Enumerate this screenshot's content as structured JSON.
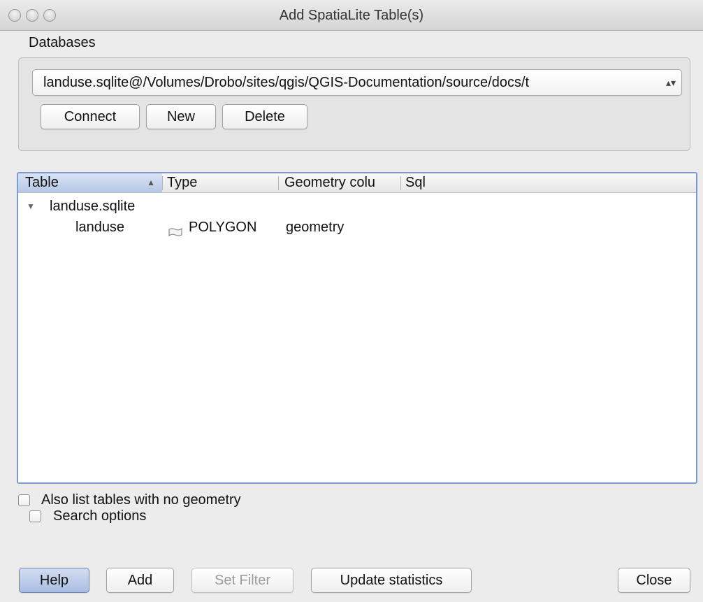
{
  "window": {
    "title": "Add SpatiaLite Table(s)"
  },
  "databases": {
    "label": "Databases",
    "selected": "landuse.sqlite@/Volumes/Drobo/sites/qgis/QGIS-Documentation/source/docs/t",
    "buttons": {
      "connect": "Connect",
      "new": "New",
      "delete": "Delete"
    }
  },
  "tree": {
    "columns": [
      "Table",
      "Type",
      "Geometry colu",
      "Sql"
    ],
    "sorted_column": "Table",
    "rows": [
      {
        "table": "landuse.sqlite",
        "type": "",
        "geometry": "",
        "sql": "",
        "expanded": true,
        "level": 0
      },
      {
        "table": "landuse",
        "type": "POLYGON",
        "geometry": "geometry",
        "sql": "",
        "level": 1,
        "icon": "polygon-icon"
      }
    ]
  },
  "options": {
    "no_geometry": {
      "label": "Also list tables with no geometry",
      "checked": false
    },
    "search": {
      "label": "Search options",
      "checked": false
    }
  },
  "footer": {
    "help": "Help",
    "add": "Add",
    "set_filter": "Set Filter",
    "update_statistics": "Update statistics",
    "close": "Close"
  },
  "colors": {
    "selection_border": "#7e9bd1",
    "default_button": "#a9bde2"
  }
}
